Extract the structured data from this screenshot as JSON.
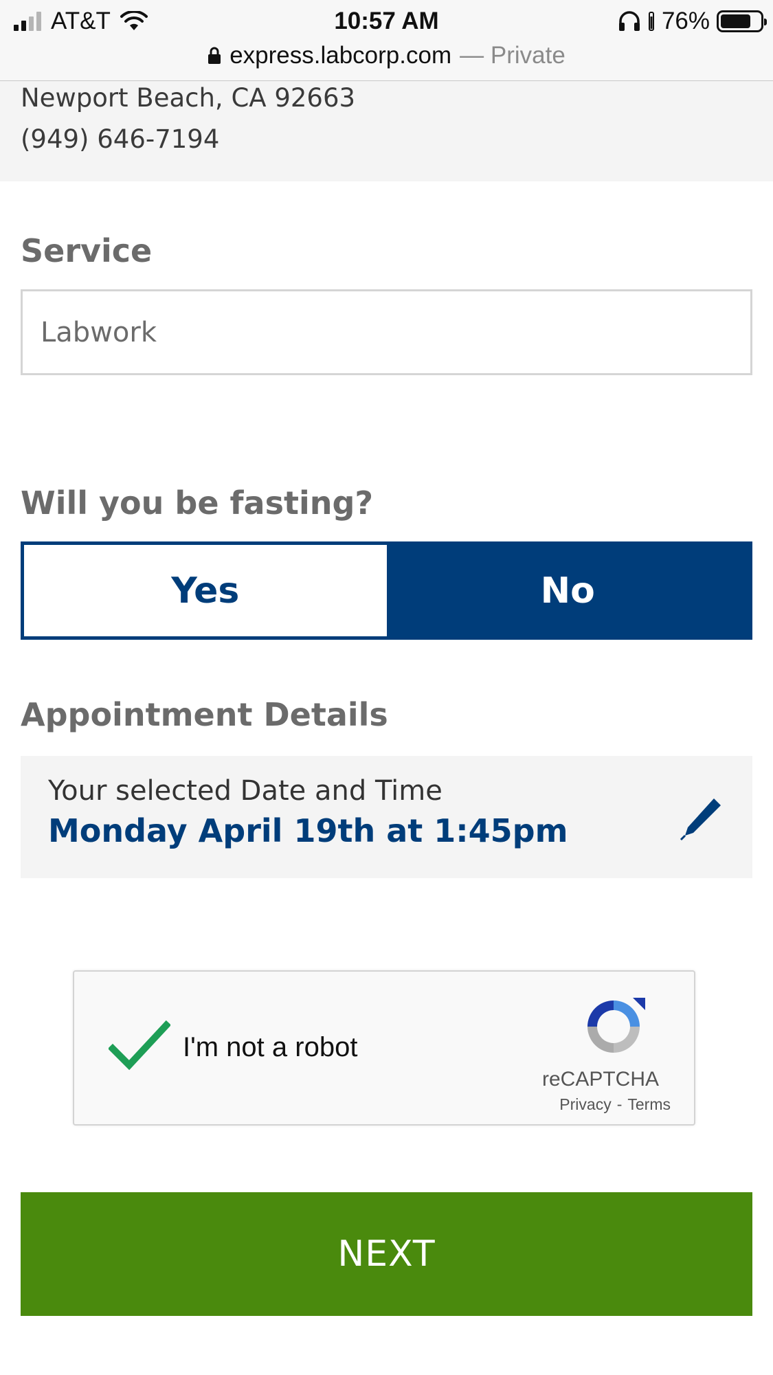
{
  "status_bar": {
    "carrier": "AT&T",
    "time": "10:57 AM",
    "battery": "76%",
    "battery_level": 0.76,
    "signal_bars": 2,
    "signal_total": 4
  },
  "browser": {
    "domain": "express.labcorp.com",
    "mode": "— Private"
  },
  "location": {
    "address_line": "Newport Beach, CA 92663",
    "phone": "(949) 646-7194"
  },
  "service": {
    "label": "Service",
    "value": "Labwork"
  },
  "fasting": {
    "label": "Will you be fasting?",
    "options": [
      "Yes",
      "No"
    ],
    "selected": "No"
  },
  "appointment": {
    "label": "Appointment Details",
    "caption": "Your selected Date and Time",
    "value": "Monday April 19th at 1:45pm"
  },
  "captcha": {
    "label": "I'm not a robot",
    "checked": true,
    "brand": "reCAPTCHA",
    "privacy": "Privacy",
    "separator": "-",
    "terms": "Terms"
  },
  "actions": {
    "next_label": "NEXT"
  },
  "colors": {
    "brand_blue": "#003d7a",
    "next_green": "#4a8a0d",
    "check_green": "#1e9e56"
  },
  "icons": {
    "edit": "pencil-icon",
    "lock": "lock-icon",
    "wifi": "wifi-icon",
    "headphones": "headphones-icon"
  }
}
